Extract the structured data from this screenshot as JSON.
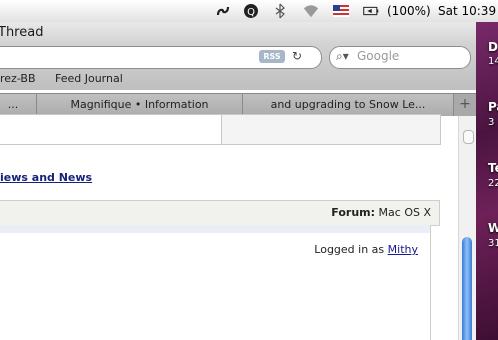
{
  "menubar": {
    "battery": "(100%)",
    "clock": "Sat 10:39"
  },
  "window": {
    "title": "Thread"
  },
  "toolbar": {
    "rss_label": "RSS",
    "search_placeholder": "Google"
  },
  "bookmarks": [
    "rez-BB",
    "Feed Journal"
  ],
  "tabs": [
    {
      "label": "..."
    },
    {
      "label": "Magnifique • Information"
    },
    {
      "label": "and upgrading to Snow Le..."
    }
  ],
  "page": {
    "views_link": "iews and News",
    "forum_label": "Forum:",
    "forum_value": "Mac OS X",
    "logged_prefix": "Logged in as",
    "username": "Mithy"
  },
  "desktop": {
    "labels": [
      {
        "title": "D",
        "sub": "14"
      },
      {
        "title": "Pa",
        "sub": "3"
      },
      {
        "title": "Te",
        "sub": "22"
      },
      {
        "title": "W",
        "sub": "31"
      }
    ]
  }
}
